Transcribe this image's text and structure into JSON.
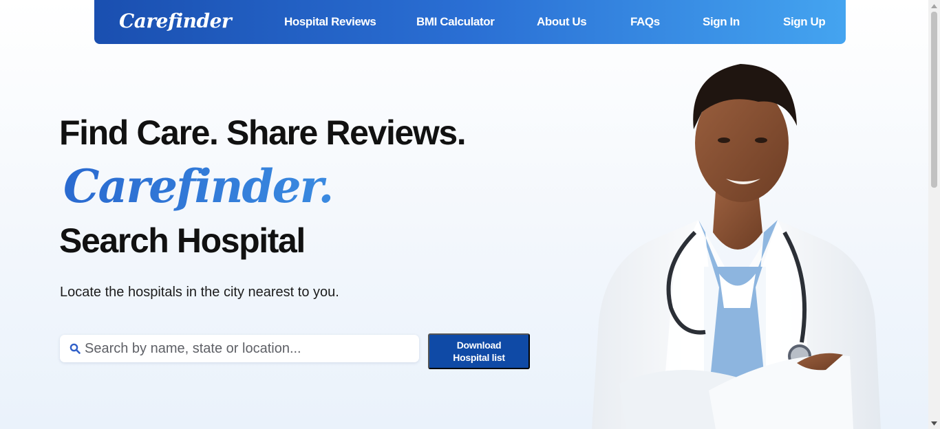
{
  "nav": {
    "logo": "Carefinder",
    "links": [
      "Hospital Reviews",
      "BMI Calculator",
      "About Us",
      "FAQs",
      "Sign In",
      "Sign Up"
    ]
  },
  "hero": {
    "headline": "Find Care. Share Reviews.",
    "brand": "Carefinder.",
    "search_title": "Search Hospital",
    "subtitle": "Locate the hospitals in the city nearest to you."
  },
  "search": {
    "placeholder": "Search by name, state or location...",
    "value": ""
  },
  "download_button": "Download Hospital list",
  "colors": {
    "nav_gradient_start": "#1a4fb0",
    "nav_gradient_end": "#44a4f0",
    "button_blue": "#0f4aa6",
    "brand_blue": "#2f74d0"
  },
  "icons": {
    "search": "search-icon",
    "hero_image": "doctor-illustration"
  }
}
